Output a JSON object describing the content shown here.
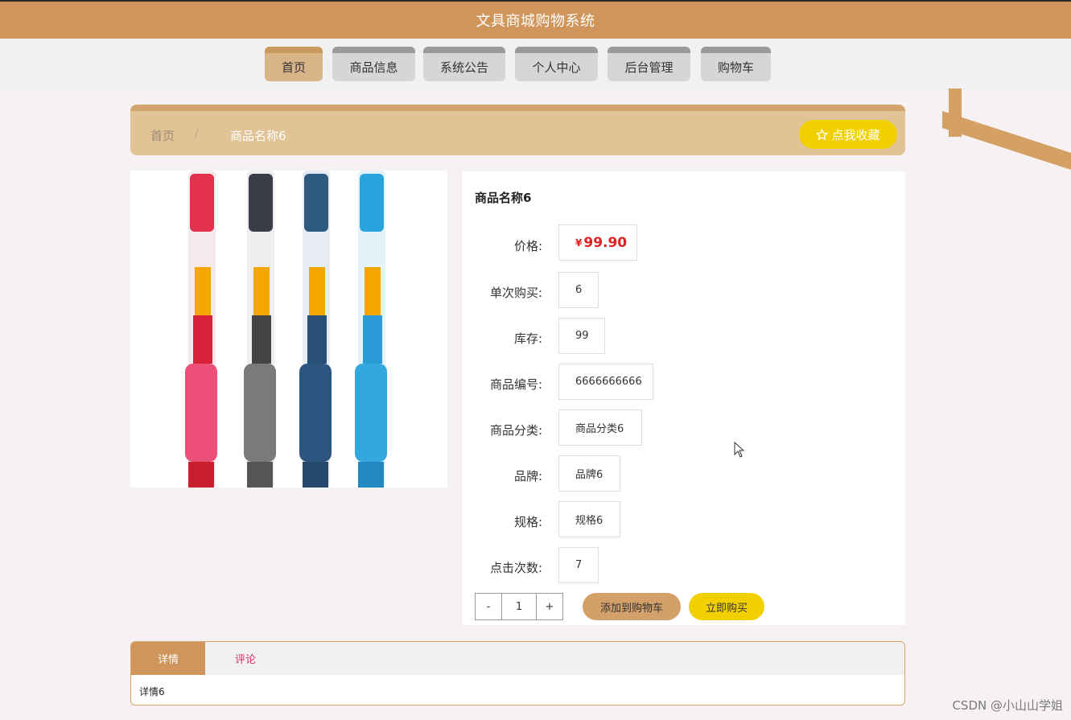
{
  "header": {
    "title": "文具商城购物系统"
  },
  "nav": {
    "items": [
      {
        "label": "首页"
      },
      {
        "label": "商品信息"
      },
      {
        "label": "系统公告"
      },
      {
        "label": "个人中心"
      },
      {
        "label": "后台管理"
      },
      {
        "label": "购物车"
      }
    ],
    "active_index": 0
  },
  "breadcrumb": {
    "home": "首页",
    "separator": "/",
    "current": "商品名称6",
    "favorite_button": "点我收藏"
  },
  "product": {
    "image_alt": "four retractable gel pens: red, black, dark blue, light blue",
    "name": "商品名称6",
    "price_label": "价格:",
    "price_currency": "¥",
    "price_value": "99.90",
    "per_purchase_label": "单次购买:",
    "per_purchase_value": "6",
    "stock_label": "库存:",
    "stock_value": "99",
    "code_label": "商品编号:",
    "code_value": "6666666666",
    "category_label": "商品分类:",
    "category_value": "商品分类6",
    "brand_label": "品牌:",
    "brand_value": "品牌6",
    "spec_label": "规格:",
    "spec_value": "规格6",
    "clicks_label": "点击次数:",
    "clicks_value": "7",
    "qty_minus": "-",
    "qty_value": "1",
    "qty_plus": "+",
    "add_to_cart": "添加到购物车",
    "buy_now": "立即购买"
  },
  "tabs": {
    "details_label": "详情",
    "comments_label": "评论",
    "details_content": "详情6"
  },
  "watermark": "CSDN @小山山学姐",
  "colors": {
    "accent": "#d0955b",
    "yellow": "#f2d000",
    "price": "#e02020"
  }
}
